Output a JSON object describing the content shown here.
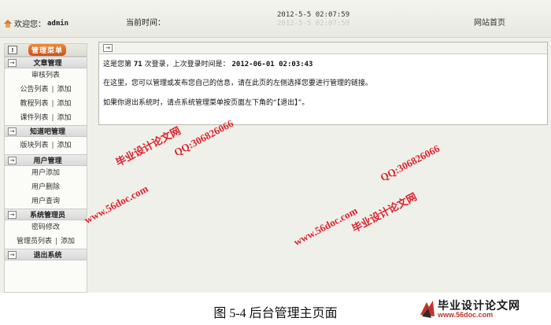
{
  "header": {
    "welcome_text": "欢迎您：",
    "username": "admin",
    "current_time_label": "当前时间：",
    "clock": "2012-5-5 02:07:59",
    "clock_echo": "2012-5-5 02:07:59",
    "home_link": "网站首页"
  },
  "sidebar": {
    "title": "管理菜单",
    "sections": [
      {
        "label": "文章管理",
        "items": [
          [
            "审核列表"
          ],
          [
            "公告列表",
            "添加"
          ],
          [
            "教程列表",
            "添加"
          ],
          [
            "课件列表",
            "添加"
          ]
        ]
      },
      {
        "label": "知道吧管理",
        "items": [
          [
            "版块列表",
            "添加"
          ]
        ]
      },
      {
        "label": "用户管理",
        "items": [
          [
            "用户添加"
          ],
          [
            "用户删除"
          ],
          [
            "用户查询"
          ]
        ]
      },
      {
        "label": "系统管理员",
        "items": [
          [
            "密码修改"
          ],
          [
            "管理员列表",
            "添加"
          ]
        ]
      },
      {
        "label": "退出系统",
        "items": []
      }
    ]
  },
  "content": {
    "line1_prefix": "这是您第",
    "login_count": "71",
    "line1_mid": "次登录，上次登录时间是：",
    "last_login": "2012-06-01 02:03:43",
    "line2": "在这里，您可以管理或发布您自己的信息，请在此页的左侧选择您要进行管理的链接。",
    "line3": "如果你退出系统时，请点系统管理菜单按页面左下角的“【退出】”。"
  },
  "watermarks": {
    "site_name": "毕业设计论文网",
    "qq": "QQ:306826066",
    "url": "www.56doc.com"
  },
  "caption": "图 5-4  后台管理主页面",
  "logo": {
    "name": "毕业设计论文网",
    "url": "www.56doc.com"
  }
}
